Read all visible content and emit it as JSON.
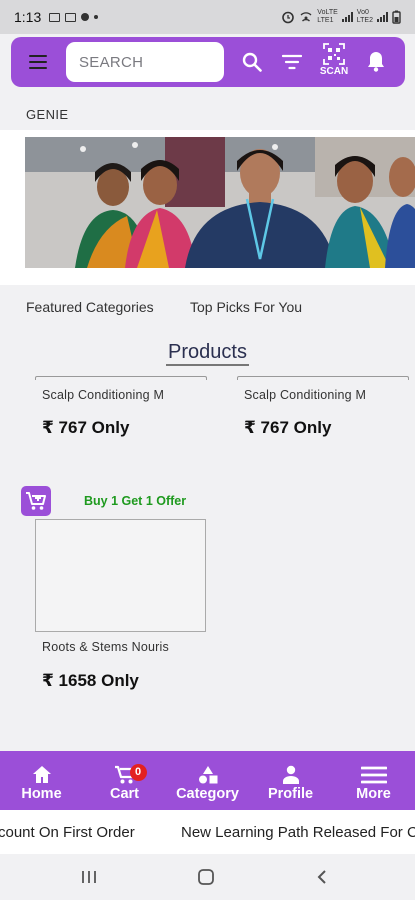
{
  "status_bar": {
    "time": "1:13",
    "network_labels": [
      "VoLTE",
      "LTE1",
      "Vo0",
      "LTE2"
    ]
  },
  "header": {
    "search": {
      "placeholder": "SEARCH",
      "value": ""
    },
    "scan_label": "SCAN",
    "icons": [
      "menu-icon",
      "search-icon",
      "filter-icon",
      "qr-scan-icon",
      "bell-icon"
    ]
  },
  "store_name": "GENIE",
  "tabs": [
    {
      "label": "Featured Categories"
    },
    {
      "label": "Top Picks For You"
    }
  ],
  "products": {
    "title": "Products",
    "items": [
      {
        "name": "Scalp Conditioning M",
        "price": "₹ 767 Only"
      },
      {
        "name": "Scalp Conditioning M",
        "price": "₹ 767 Only"
      },
      {
        "name": "Roots & Stems Nouris",
        "price": "₹ 1658 Only",
        "offer": "Buy 1 Get 1 Offer"
      }
    ]
  },
  "bottom_nav": {
    "items": [
      {
        "label": "Home",
        "icon": "home-icon"
      },
      {
        "label": "Cart",
        "icon": "cart-icon",
        "badge": "0"
      },
      {
        "label": "Category",
        "icon": "category-icon"
      },
      {
        "label": "Profile",
        "icon": "profile-icon"
      },
      {
        "label": "More",
        "icon": "more-icon"
      }
    ]
  },
  "ticker": {
    "items": [
      "count On First Order",
      "New Learning Path Released For C"
    ]
  },
  "colors": {
    "brand": "#9b4fd8",
    "offer": "#1f9a1f",
    "badge": "#e32121"
  }
}
